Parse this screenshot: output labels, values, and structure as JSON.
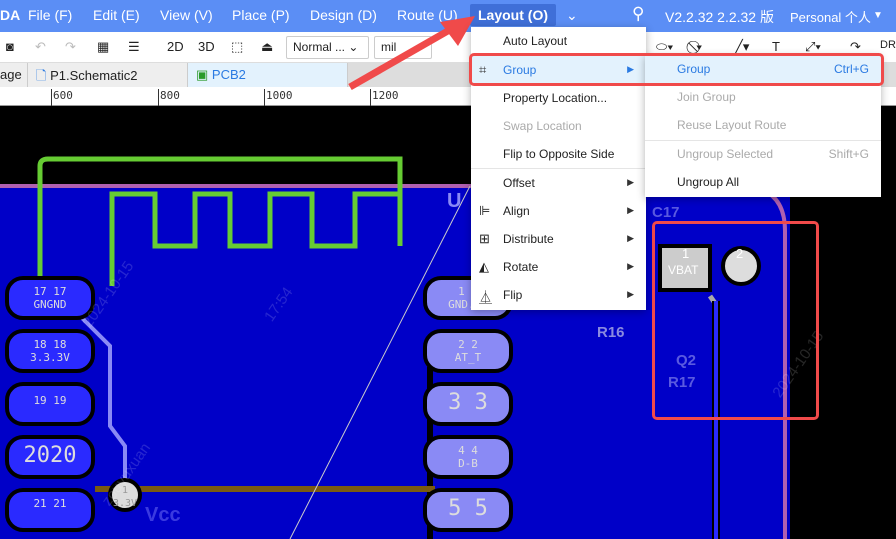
{
  "menubar": {
    "logo": "DA",
    "items": [
      "File (F)",
      "Edit (E)",
      "View (V)",
      "Place (P)",
      "Design (D)",
      "Route (U)",
      "Layout (O)"
    ],
    "version": "V2.2.32 2.2.32 版",
    "account": "Personal 个人"
  },
  "toolbar": {
    "b2d": "2D",
    "b3d": "3D",
    "layer_select": "Normal ...",
    "unit_select": "mil",
    "drc": "DRC"
  },
  "tabs": [
    {
      "label": "age"
    },
    {
      "label": "P1.Schematic2"
    },
    {
      "label": "PCB2"
    }
  ],
  "ruler": [
    "600",
    "800",
    "1000",
    "1200"
  ],
  "layout_menu": {
    "items": [
      {
        "label": "Auto Layout",
        "enabled": true
      },
      {
        "label": "Group",
        "enabled": true,
        "submenu": true,
        "icon": "group-icon"
      },
      {
        "label": "Property Location...",
        "enabled": true
      },
      {
        "label": "Swap Location",
        "enabled": false
      },
      {
        "label": "Flip to Opposite Side",
        "enabled": true
      },
      {
        "label": "Offset",
        "enabled": true,
        "submenu": true
      },
      {
        "label": "Align",
        "enabled": true,
        "submenu": true,
        "icon": "align-icon"
      },
      {
        "label": "Distribute",
        "enabled": true,
        "submenu": true,
        "icon": "distribute-icon"
      },
      {
        "label": "Rotate",
        "enabled": true,
        "submenu": true,
        "icon": "rotate-icon"
      },
      {
        "label": "Flip",
        "enabled": true,
        "submenu": true,
        "icon": "flip-icon"
      }
    ]
  },
  "group_submenu": {
    "items": [
      {
        "label": "Group",
        "shortcut": "Ctrl+G",
        "enabled": true
      },
      {
        "label": "Join Group",
        "enabled": false
      },
      {
        "label": "Reuse Layout Route",
        "enabled": false
      },
      {
        "label": "Ungroup Selected",
        "shortcut": "Shift+G",
        "enabled": false
      },
      {
        "label": "Ungroup All",
        "enabled": true
      }
    ]
  },
  "pcb": {
    "left_pads": [
      "17 17\nGNGND",
      "18 18\n3.3.3V",
      "19 19",
      "2020",
      "21 21"
    ],
    "right_pads": [
      "1 1\nGND.NC",
      "2 2\nAT_T",
      "3 3",
      "4 4\nD-B",
      "5 5"
    ],
    "labels": {
      "u": "U",
      "vcc": "Vcc",
      "pin1": "1\n3.3V",
      "c17": "C17",
      "r16": "R16",
      "q2": "Q2",
      "r17": "R17",
      "vbat_num": "1",
      "vbat": "VBAT",
      "pad2": "2"
    },
    "watermark": [
      "2024-10-15",
      "17:54",
      "zouyuxuan"
    ]
  },
  "colors": {
    "menubar": "#5b8ef5",
    "highlight": "#f04a4a",
    "copper": "#0000c8",
    "silk_green": "#66cc33"
  }
}
